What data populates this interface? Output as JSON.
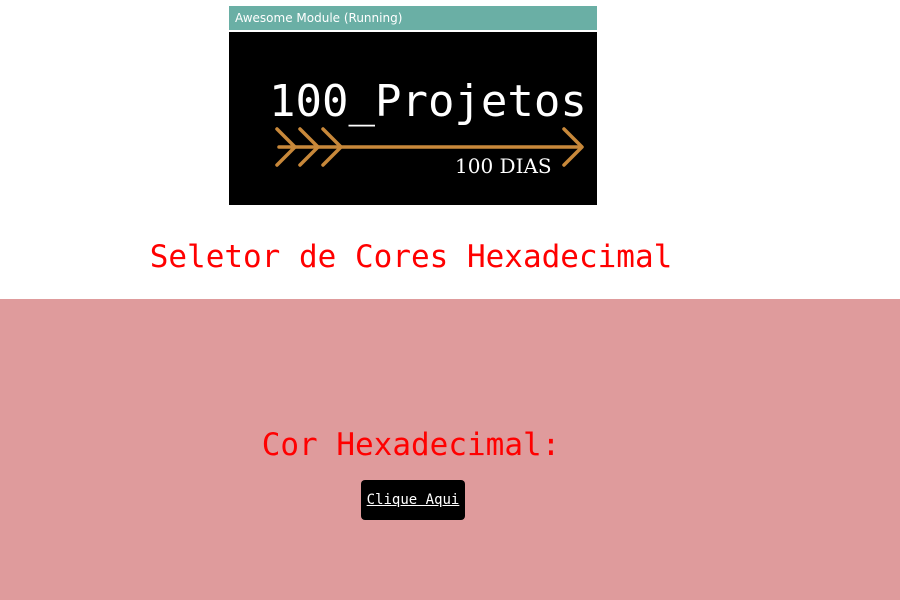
{
  "banner": {
    "window_title": "Awesome Module (Running)",
    "logo_text": "100_Projetos",
    "logo_subtext": "100 DIAS",
    "arrow_color": "#c8883a",
    "titlebar_color": "#6aafa5"
  },
  "heading": "Seletor de Cores Hexadecimal",
  "color_panel": {
    "label": "Cor Hexadecimal:",
    "background": "#df9b9c",
    "button_label": "Clique Aqui"
  }
}
